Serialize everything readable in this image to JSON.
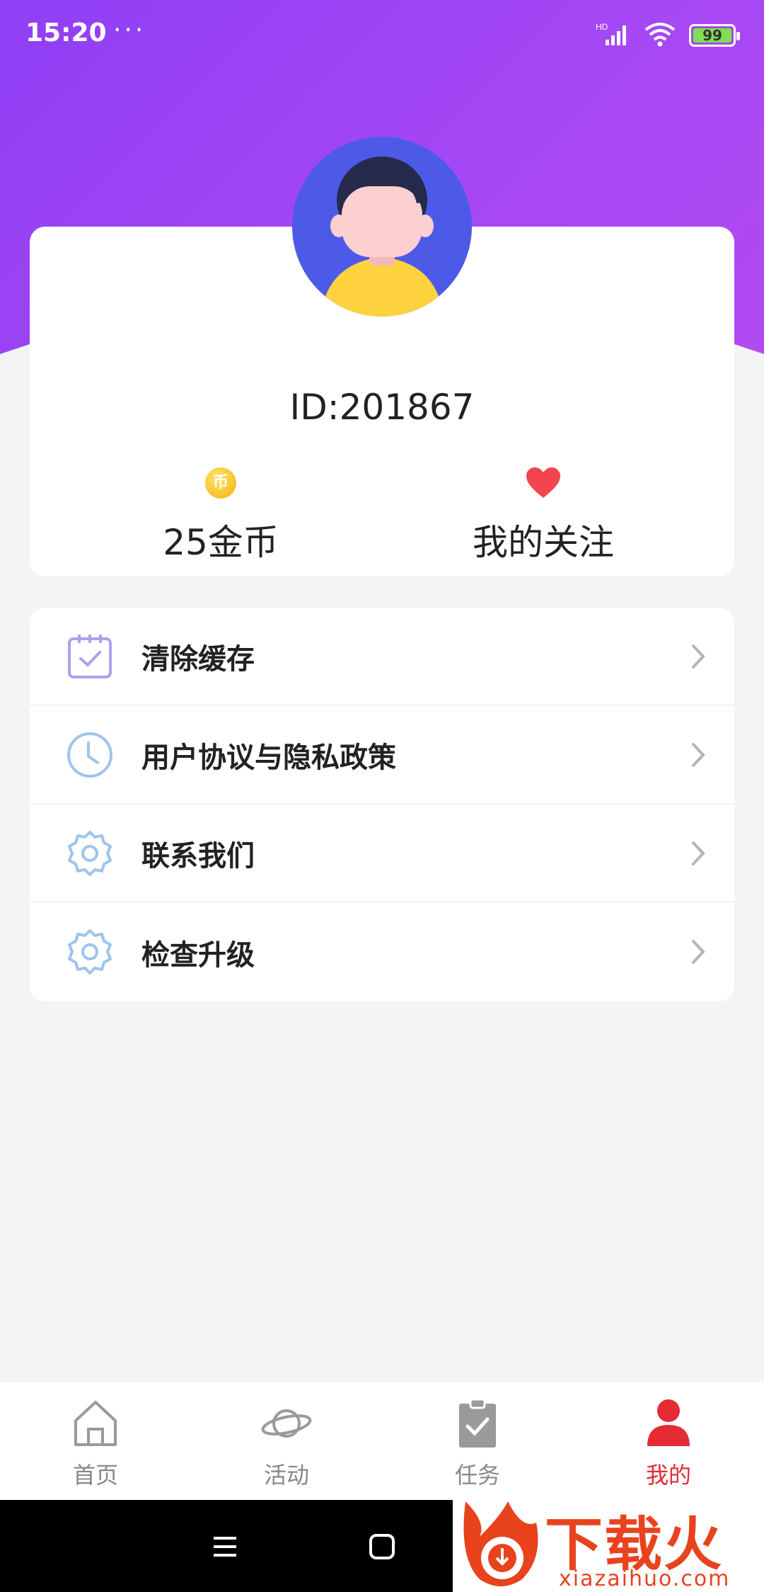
{
  "status_bar": {
    "time": "15:20",
    "dots": "···",
    "network_label": "HD",
    "battery_level": "99",
    "battery_color": "#7ee04a"
  },
  "theme": {
    "header_gradient": [
      "#8f3ff5",
      "#b24af2"
    ],
    "accent_red": "#e52b34",
    "icon_blue": "#9ec4ee",
    "icon_purple": "#a9a4e8"
  },
  "profile": {
    "user_id": "ID:201867",
    "coin_icon_glyph": "币",
    "coins_label": "25金币",
    "follow_label": "我的关注",
    "follow_icon": "heart-icon"
  },
  "menu": {
    "items": [
      {
        "label": "清除缓存",
        "icon": "calendar-check-icon"
      },
      {
        "label": "用户协议与隐私政策",
        "icon": "clock-icon"
      },
      {
        "label": "联系我们",
        "icon": "gear-icon"
      },
      {
        "label": "检查升级",
        "icon": "gear-icon"
      }
    ]
  },
  "tabbar": {
    "tabs": [
      {
        "label": "首页",
        "icon": "home-icon",
        "active": false
      },
      {
        "label": "活动",
        "icon": "planet-icon",
        "active": false
      },
      {
        "label": "任务",
        "icon": "clipboard-check-icon",
        "active": false
      },
      {
        "label": "我的",
        "icon": "user-icon",
        "active": true
      }
    ]
  },
  "watermark": {
    "title": "下载火",
    "url": "xiazaihuo.com"
  }
}
